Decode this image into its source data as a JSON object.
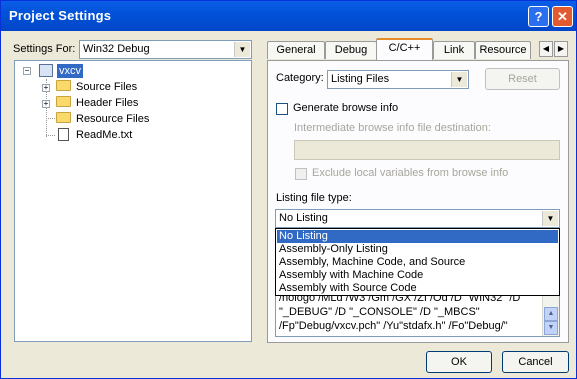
{
  "window": {
    "title": "Project Settings",
    "help_glyph": "?",
    "close_glyph": "✕"
  },
  "left": {
    "settings_for_label": "Settings For:",
    "settings_for_value": "Win32 Debug",
    "tree": {
      "root": "vxcv",
      "items": [
        "Source Files",
        "Header Files",
        "Resource Files",
        "ReadMe.txt"
      ]
    }
  },
  "tabs": [
    "General",
    "Debug",
    "C/C++",
    "Link",
    "Resource"
  ],
  "active_tab": "C/C++",
  "panel": {
    "category_label": "Category:",
    "category_value": "Listing Files",
    "reset_label": "Reset",
    "generate_browse_label": "Generate browse info",
    "intermediate_label": "Intermediate browse info file destination:",
    "exclude_label": "Exclude local variables from browse info",
    "listing_type_label": "Listing file type:",
    "listing_type_value": "No Listing",
    "listing_options": [
      "No Listing",
      "Assembly-Only Listing",
      "Assembly, Machine Code, and Source",
      "Assembly with Machine Code",
      "Assembly with Source Code"
    ],
    "project_options_lines": [
      "/nologo /MLd /W3 /Gm /GX /ZI /Od /D \"WIN32\" /D",
      "\"_DEBUG\" /D \"_CONSOLE\" /D \"_MBCS\"",
      "/Fp\"Debug/vxcv.pch\" /Yu\"stdafx.h\" /Fo\"Debug/\""
    ]
  },
  "footer": {
    "ok_label": "OK",
    "cancel_label": "Cancel"
  },
  "colors": {
    "titlebar": "#0252d8",
    "selection": "#316ac5",
    "tab_highlight": "#e68b2c"
  }
}
